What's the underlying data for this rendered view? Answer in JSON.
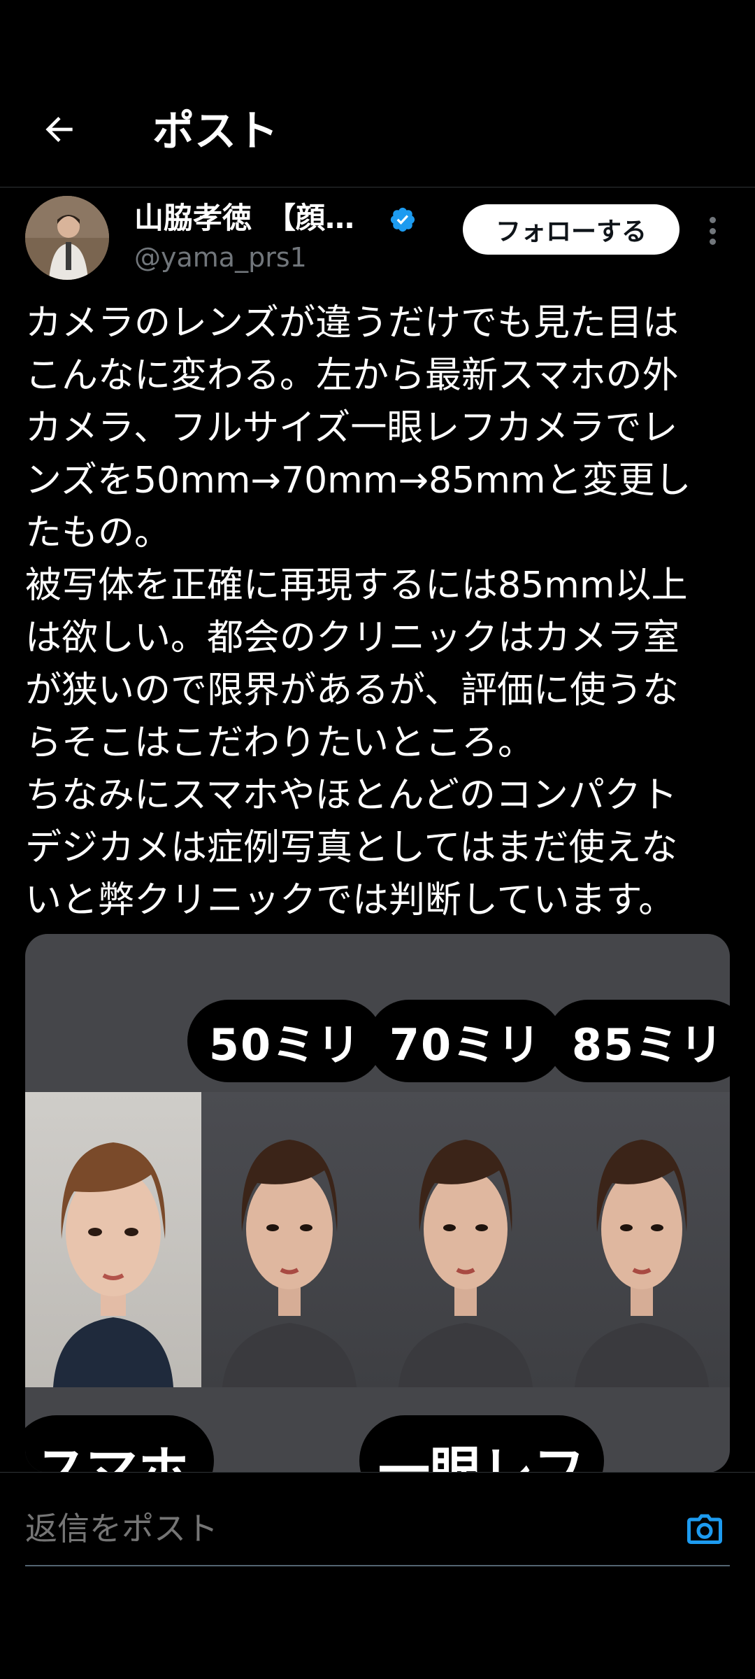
{
  "header": {
    "title": "ポスト",
    "back_icon": "arrow-left-icon"
  },
  "author": {
    "name": "山脇孝徳　【顔…",
    "handle": "@yama_prs1",
    "verified": true,
    "follow_label": "フォローする",
    "accent": "#1d9bf0"
  },
  "post": {
    "text": "カメラのレンズが違うだけでも見た目は\nこんなに変わる。左から最新スマホの外\nカメラ、フルサイズ一眼レフカメラでレ\nンズを50mm→70mm→85mmと変更し\nたもの。\n被写体を正確に再現するには85mm以上\nは欲しい。都会のクリニックはカメラ室\nが狭いので限界があるが、評価に使うな\nらそこはこだわりたいところ。\nちなみにスマホやほとんどのコンパクト\nデジカメは症例写真としてはまだ使えな\nいと弊クリニックでは判断しています。"
  },
  "media": {
    "lens_labels": [
      "50ミリ",
      "70ミリ",
      "85ミリ"
    ],
    "bottom_labels": [
      "スマホ",
      "一眼レフ"
    ]
  },
  "reply": {
    "placeholder": "返信をポスト",
    "camera_icon": "camera-icon",
    "accent": "#1d9bf0"
  }
}
